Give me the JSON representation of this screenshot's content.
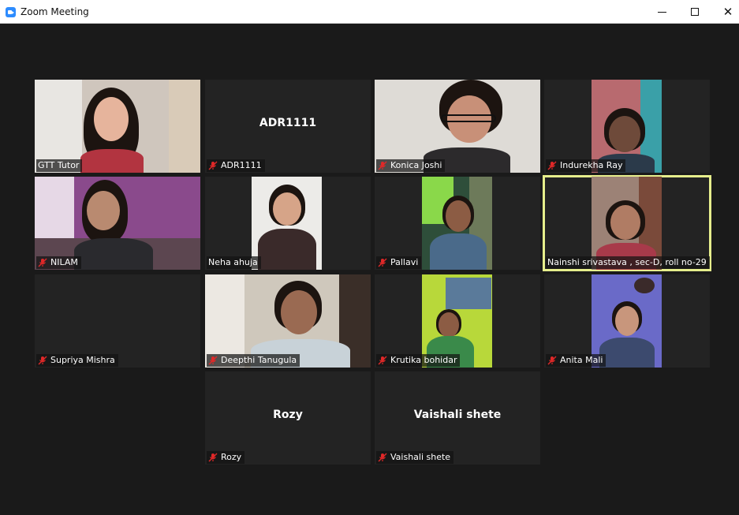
{
  "window": {
    "title": "Zoom Meeting",
    "minimize_symbol": "",
    "maximize_symbol": "",
    "close_symbol": "✕"
  },
  "participants": [
    {
      "name": "GTT Tutor",
      "video": true
    },
    {
      "name": "ADR1111",
      "video": false,
      "center_name": "ADR1111"
    },
    {
      "name": "Konica Joshi",
      "video": true
    },
    {
      "name": "Indurekha Ray",
      "video": true
    },
    {
      "name": "NILAM",
      "video": true
    },
    {
      "name": "Neha ahuja",
      "video": true
    },
    {
      "name": "Pallavi",
      "video": true
    },
    {
      "name": "Nainshi srivastava , sec-D, roll no-29",
      "video": true,
      "active_speaker": true
    },
    {
      "name": "Supriya Mishra",
      "video": false
    },
    {
      "name": "Deepthi Tanugula",
      "video": true
    },
    {
      "name": "Krutika bohidar",
      "video": true
    },
    {
      "name": "Anita Mali",
      "video": true
    },
    {
      "name": "Rozy",
      "video": false,
      "center_name": "Rozy"
    },
    {
      "name": "Vaishali shete",
      "video": false,
      "center_name": "Vaishali shete"
    }
  ],
  "icons": {
    "mute": "muted-microphone-icon",
    "app": "zoom-app-icon"
  },
  "colors": {
    "background": "#1a1a1a",
    "tile": "#232323",
    "active_outline": "#e6ee8c",
    "mute": "#e02828"
  }
}
